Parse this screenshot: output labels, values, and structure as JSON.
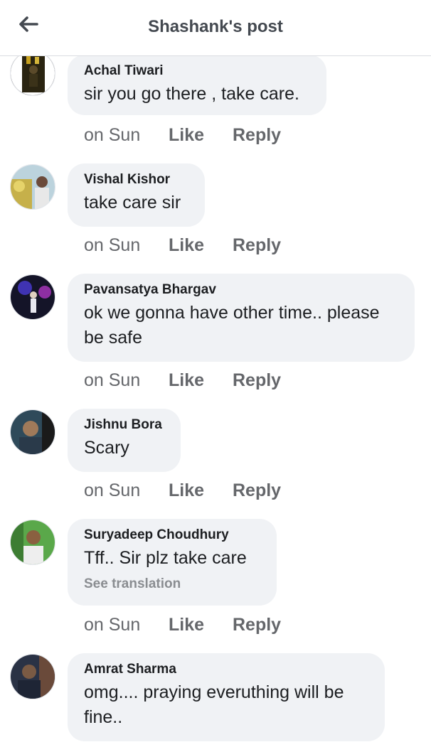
{
  "header": {
    "title": "Shashank's post",
    "back_icon": "arrow-left-icon"
  },
  "comments": [
    {
      "name": "Achal Tiwari",
      "text": "sir you go there , take care.",
      "time": "on Sun",
      "like": "Like",
      "reply": "Reply"
    },
    {
      "name": "Vishal Kishor",
      "text": "take care sir",
      "time": "on Sun",
      "like": "Like",
      "reply": "Reply"
    },
    {
      "name": "Pavansatya Bhargav",
      "text": "ok we gonna have other time.. please be safe",
      "time": "on Sun",
      "like": "Like",
      "reply": "Reply"
    },
    {
      "name": "Jishnu Bora",
      "text": "Scary",
      "time": "on Sun",
      "like": "Like",
      "reply": "Reply"
    },
    {
      "name": "Suryadeep Choudhury",
      "text": "Tff.. Sir plz take care",
      "translation": "See translation",
      "time": "on Sun",
      "like": "Like",
      "reply": "Reply"
    },
    {
      "name": "Amrat Sharma",
      "text": "omg....  praying everuthing will be fine.."
    }
  ]
}
